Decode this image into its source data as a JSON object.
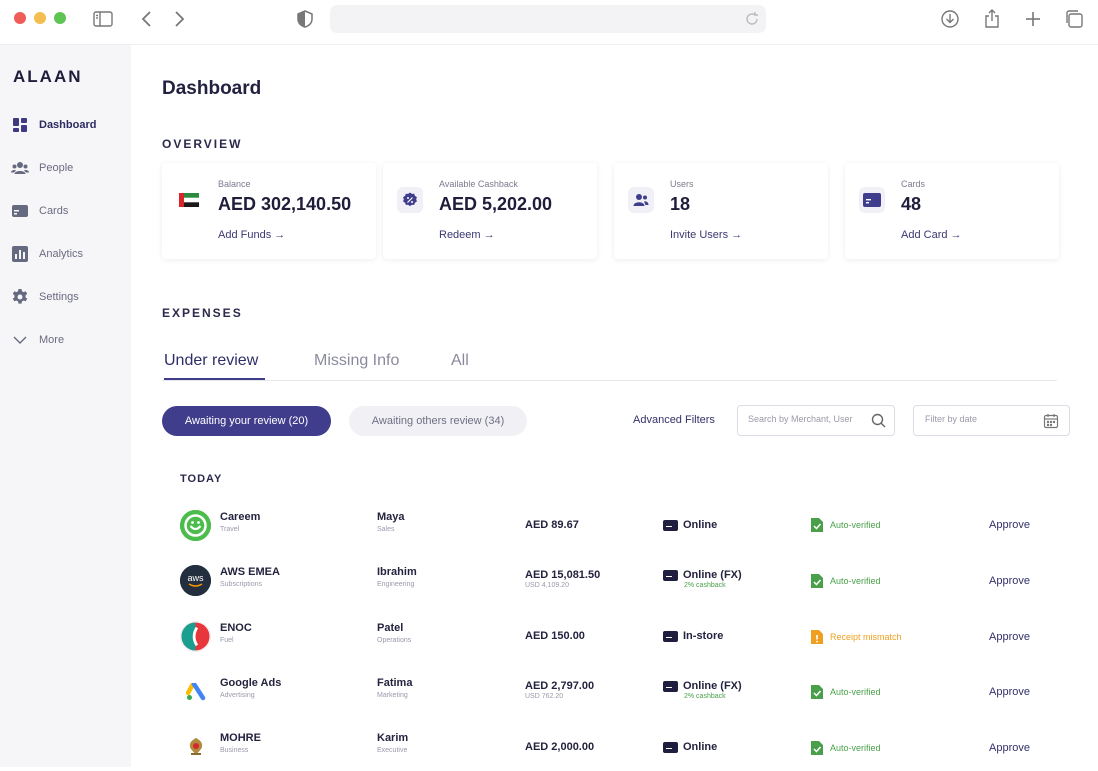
{
  "sidebar": {
    "logo": "ALAAN",
    "items": [
      {
        "label": "Dashboard",
        "icon": "dashboard-icon"
      },
      {
        "label": "People",
        "icon": "people-icon"
      },
      {
        "label": "Cards",
        "icon": "card-icon"
      },
      {
        "label": "Analytics",
        "icon": "analytics-icon"
      },
      {
        "label": "Settings",
        "icon": "gear-icon"
      },
      {
        "label": "More",
        "icon": "chevron-down-icon"
      }
    ]
  },
  "main": {
    "title": "Dashboard",
    "overview_label": "OVERVIEW",
    "cards": [
      {
        "label": "Balance",
        "value": "AED 302,140.50",
        "action": "Add Funds →"
      },
      {
        "label": "Available Cashback",
        "value": "AED 5,202.00",
        "action": "Redeem →"
      },
      {
        "label": "Users",
        "value": "18",
        "action": "Invite Users →"
      },
      {
        "label": "Cards",
        "value": "48",
        "action": "Add Card →"
      }
    ],
    "expenses_label": "EXPENSES",
    "tabs": [
      {
        "label": "Under review",
        "active": true
      },
      {
        "label": "Missing Info"
      },
      {
        "label": "All"
      }
    ],
    "filters": {
      "awaiting_you": "Awaiting your review (20)",
      "awaiting_others": "Awaiting others review (34)",
      "advanced": "Advanced Filters",
      "search_placeholder": "Search by Merchant, User",
      "date_placeholder": "Filter by date"
    },
    "group_label": "TODAY",
    "expenses": [
      {
        "merchant": "Careem",
        "category": "Travel",
        "person": "Maya",
        "dept": "Sales",
        "amount": "AED 89.67",
        "fx_amount": "",
        "channel": "Online",
        "cashback": "",
        "status": "Auto-verified",
        "status_type": "ok",
        "action": "Approve",
        "logo": "careem-logo"
      },
      {
        "merchant": "AWS EMEA",
        "category": "Subscriptions",
        "person": "Ibrahim",
        "dept": "Engineering",
        "amount": "AED 15,081.50",
        "fx_amount": "USD 4,109.20",
        "channel": "Online (FX)",
        "cashback": "2% cashback",
        "status": "Auto-verified",
        "status_type": "ok",
        "action": "Approve",
        "logo": "aws-logo"
      },
      {
        "merchant": "ENOC",
        "category": "Fuel",
        "person": "Patel",
        "dept": "Operations",
        "amount": "AED 150.00",
        "fx_amount": "",
        "channel": "In-store",
        "cashback": "",
        "status": "Receipt mismatch",
        "status_type": "warn",
        "action": "Approve",
        "logo": "enoc-logo"
      },
      {
        "merchant": "Google Ads",
        "category": "Advertising",
        "person": "Fatima",
        "dept": "Marketing",
        "amount": "AED 2,797.00",
        "fx_amount": "USD 762.20",
        "channel": "Online (FX)",
        "cashback": "2% cashback",
        "status": "Auto-verified",
        "status_type": "ok",
        "action": "Approve",
        "logo": "google-ads-logo"
      },
      {
        "merchant": "MOHRE",
        "category": "Business",
        "person": "Karim",
        "dept": "Executive",
        "amount": "AED 2,000.00",
        "fx_amount": "",
        "channel": "Online",
        "cashback": "",
        "status": "Auto-verified",
        "status_type": "ok",
        "action": "Approve",
        "logo": "mohre-logo"
      }
    ]
  },
  "colors": {
    "accent": "#403d8c",
    "ok": "#4aa04a",
    "warn": "#f0a020"
  }
}
